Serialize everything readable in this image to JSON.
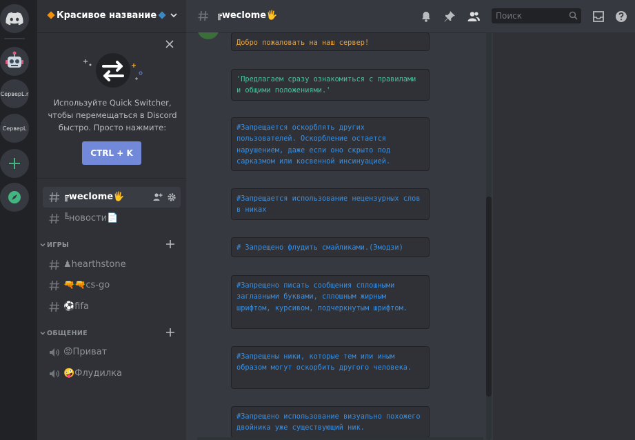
{
  "rail": {
    "servers": [
      {
        "label": "СерверL.r"
      },
      {
        "label": "СерверL"
      }
    ]
  },
  "guild": {
    "name": "Красивое название",
    "quick_switcher": {
      "text": "Используйте Quick Switcher, чтобы перемещаться в Discord быстро. Просто нажмите:",
      "button": "CTRL + K"
    }
  },
  "channels": {
    "top": [
      {
        "name": "╔weclome🖐"
      },
      {
        "name": "╚новости📄"
      }
    ],
    "categories": [
      {
        "name": "ИГРЫ",
        "items": [
          {
            "name": "♟hearthstone"
          },
          {
            "name": "🔫🔫cs-go"
          },
          {
            "name": "⚽fifa"
          }
        ]
      },
      {
        "name": "ОБЩЕНИЕ",
        "items": [
          {
            "name": "😡Приват"
          },
          {
            "name": "🤪Флудилка"
          }
        ]
      }
    ]
  },
  "header": {
    "channel": "╔weclome🖐",
    "search_placeholder": "Поиск"
  },
  "messages": [
    {
      "text": "Добро пожаловать на наш сервер!",
      "color": "#e5a13c"
    },
    {
      "text": "'Предлагаем сразу ознакомиться с правилами и общими положениями.'",
      "color": "#4fbf9f"
    },
    {
      "text": "#Запрещается оскорблять других пользователей. Оскорбление остается нарушением, даже если оно скрыто под сарказмом или косвенной инсинуацией.",
      "color": "#3b8fe0"
    },
    {
      "text": "#Запрещается использование нецензурных слов в никах",
      "color": "#3b8fe0"
    },
    {
      "text": "# Запрещено флудить смайликами.(Эмодзи)",
      "color": "#3b8fe0"
    },
    {
      "text": "#Запрещено писать сообщения сплошными заглавными буквами, сплошным жирным шрифтом, курсивом, подчеркнутым шрифтом.",
      "color": "#3b8fe0"
    },
    {
      "text": "#Запрещены ники, которые тем или иным образом могут оскорбить другого человека.",
      "color": "#3b8fe0"
    },
    {
      "text": "#Запрещено использование визуально похожего двойника уже существующий ник.",
      "color": "#3b8fe0"
    }
  ]
}
